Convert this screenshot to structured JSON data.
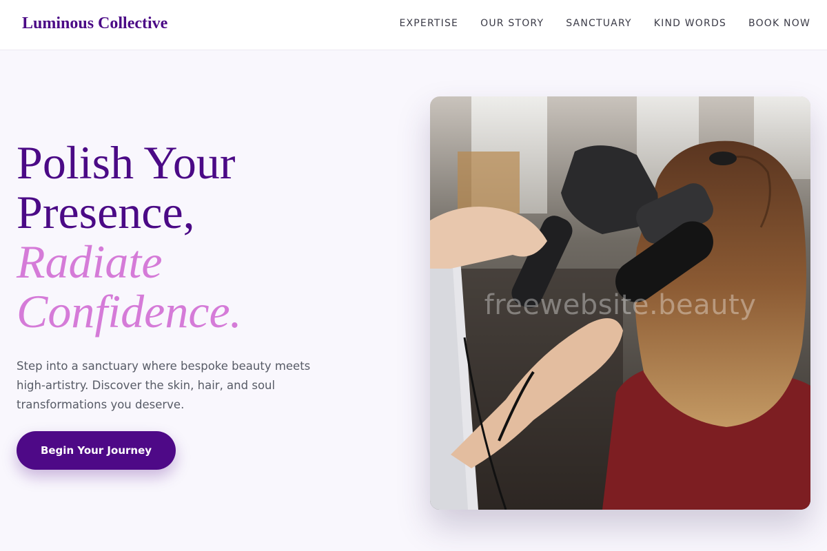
{
  "brand": {
    "name": "Luminous Collective"
  },
  "nav": {
    "items": [
      {
        "label": "EXPERTISE"
      },
      {
        "label": "OUR STORY"
      },
      {
        "label": "SANCTUARY"
      },
      {
        "label": "KIND WORDS"
      },
      {
        "label": "BOOK NOW"
      }
    ]
  },
  "hero": {
    "heading_line1": "Polish Your",
    "heading_line2": "Presence,",
    "heading_accent_line1": "Radiate",
    "heading_accent_line2": "Confidence.",
    "subtitle": "Step into a sanctuary where bespoke beauty meets high-artistry. Discover the skin, hair, and soul transformations you deserve.",
    "cta_label": "Begin Your Journey"
  },
  "image": {
    "watermark": "freewebsite.beauty"
  },
  "colors": {
    "brand_purple": "#4b0a86",
    "accent_pink": "#d57bd8",
    "background": "#f9f7fd"
  }
}
